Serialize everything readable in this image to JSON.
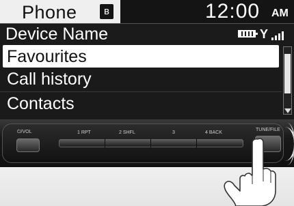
{
  "status_bar": {
    "title": "Phone",
    "bluetooth_icon": "bluetooth-icon",
    "time": "12:00",
    "ampm": "AM"
  },
  "device": {
    "name": "Device Name",
    "battery_icon": "battery-icon",
    "signal_icon": "signal-icon",
    "signal_label": "Y"
  },
  "menu": {
    "items": [
      {
        "label": "Favourites",
        "selected": true
      },
      {
        "label": "Call history",
        "selected": false
      },
      {
        "label": "Contacts",
        "selected": false
      }
    ]
  },
  "panel": {
    "vol_label": "⏻/VOL",
    "tune_label": "TUNE/FILE",
    "presets": [
      "1 RPT",
      "2 SHFL",
      "3",
      "4 BACK"
    ]
  },
  "colors": {
    "screen_bg": "#1a1a1a",
    "status_bg": "#efefef",
    "highlight": "#ffffff"
  }
}
